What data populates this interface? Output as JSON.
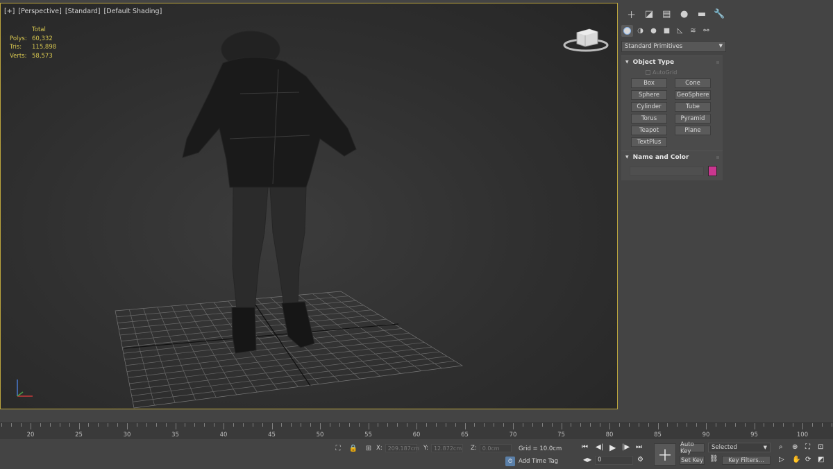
{
  "viewport": {
    "labels": [
      "[+]",
      "[Perspective]",
      "[Standard]",
      "[Default Shading]"
    ],
    "stats": {
      "header": "Total",
      "rows": [
        {
          "key": "Polys:",
          "value": "60,332"
        },
        {
          "key": "Tris:",
          "value": "115,898"
        },
        {
          "key": "Verts:",
          "value": "58,573"
        }
      ]
    }
  },
  "command_panel": {
    "tabs": [
      "create-icon",
      "modify-icon",
      "hierarchy-icon",
      "motion-icon",
      "display-icon",
      "utilities-icon"
    ],
    "category_dropdown": "Standard Primitives",
    "object_type": {
      "title": "Object Type",
      "autogrid": "AutoGrid",
      "buttons": [
        "Box",
        "Cone",
        "Sphere",
        "GeoSphere",
        "Cylinder",
        "Tube",
        "Torus",
        "Pyramid",
        "Teapot",
        "Plane",
        "TextPlus"
      ]
    },
    "name_and_color": {
      "title": "Name and Color",
      "swatch_color": "#c9368f"
    }
  },
  "timeline": {
    "labels": [
      "20",
      "25",
      "30",
      "35",
      "40",
      "45",
      "50",
      "55",
      "60",
      "65",
      "70",
      "75",
      "80",
      "85",
      "90",
      "95",
      "100"
    ]
  },
  "status_bar": {
    "x_label": "X:",
    "x_value": "209.187cm",
    "y_label": "Y:",
    "y_value": "12.872cm",
    "z_label": "Z:",
    "z_value": "0.0cm",
    "grid": "Grid = 10.0cm",
    "add_time_tag": "Add Time Tag",
    "frame_value": "0",
    "auto_key": "Auto Key",
    "set_key": "Set Key",
    "selected": "Selected",
    "key_filters": "Key Filters..."
  }
}
